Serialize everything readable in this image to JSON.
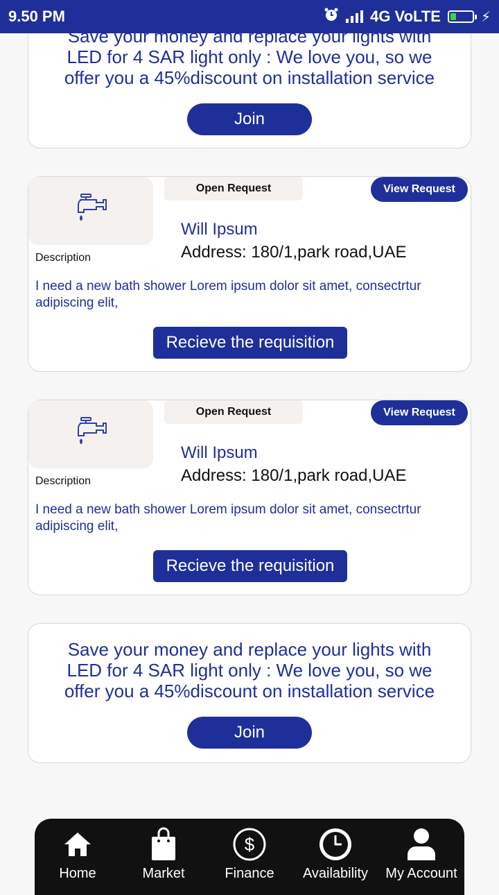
{
  "status_bar": {
    "time": "9.50 PM",
    "network": "4G VoLTE",
    "alarm_icon": "alarm-icon",
    "battery_icon": "battery-low-icon"
  },
  "promo_top": {
    "text": "Save your money and replace your lights with LED for 4 SAR light only : We love you, so we offer you a 45%discount on installation service",
    "button": "Join"
  },
  "requests": [
    {
      "status": "Open Request",
      "view_button": "View Request",
      "name": "Will Ipsum",
      "address": "Address: 180/1,park road,UAE",
      "description_label": "Description",
      "description": "I need a new bath shower Lorem ipsum dolor sit amet, consectrtur adipiscing elit,",
      "action_button": "Recieve the requisition",
      "icon": "faucet-icon"
    },
    {
      "status": "Open Request",
      "view_button": "View Request",
      "name": "Will Ipsum",
      "address": "Address: 180/1,park road,UAE",
      "description_label": "Description",
      "description": "I need a new bath shower Lorem ipsum dolor sit amet, consectrtur adipiscing elit,",
      "action_button": "Recieve the requisition",
      "icon": "faucet-icon"
    }
  ],
  "promo_bottom": {
    "text": "Save your money and replace your lights with LED for 4 SAR light only : We love you, so we offer you a 45%discount on installation service",
    "button": "Join"
  },
  "bottom_nav": [
    {
      "label": "Home",
      "icon": "home-icon"
    },
    {
      "label": "Market",
      "icon": "shopping-bag-icon"
    },
    {
      "label": "Finance",
      "icon": "dollar-icon"
    },
    {
      "label": "Availability",
      "icon": "clock-icon"
    },
    {
      "label": "My Account",
      "icon": "user-icon"
    }
  ],
  "colors": {
    "primary": "#1f2f9a",
    "card_bg": "#ffffff",
    "page_bg": "#f7f7f7",
    "thumb_bg": "#f4f1ef",
    "nav_bg": "#111111"
  }
}
